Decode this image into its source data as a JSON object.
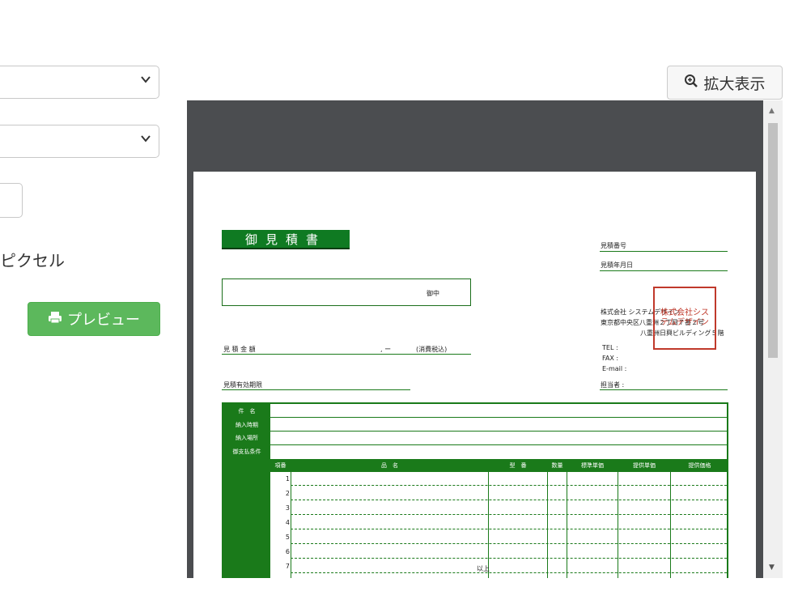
{
  "left_panel": {
    "unit_label": "ピクセル",
    "preview_button_label": "プレビュー",
    "preview_icon": "print-icon"
  },
  "toolbar": {
    "zoom_button_label": "拡大表示",
    "zoom_icon": "zoom-in-icon"
  },
  "document": {
    "title": "御見積書",
    "estimate_number_label": "見積番号",
    "estimate_date_label": "見積年月日",
    "addressee_suffix": "御中",
    "company_name": "株式会社 システムデザイン",
    "company_address_1": "東京都中央区八重洲２丁目７番２号",
    "company_address_2": "八重洲日興ビルディング５階",
    "stamp_text": "株式会社システムデザイン",
    "tel_label": "TEL  :",
    "fax_label": "FAX  :",
    "email_label": "E-mail :",
    "staff_label": "担当者 :",
    "amount_label": "見 積 金 額",
    "amount_value": ", ー",
    "tax_note": "(消費税込)",
    "validity_label": "見積有効期限",
    "form_labels": [
      "件　名",
      "納入時期",
      "納入場所",
      "御支払条件"
    ],
    "item_headers": [
      "項番",
      "品　名",
      "型　番",
      "数量",
      "標準単価",
      "提供単価",
      "提供価格"
    ],
    "row_numbers": [
      "1",
      "2",
      "3",
      "4",
      "5",
      "6",
      "7"
    ],
    "end_marker": "以上"
  },
  "colors": {
    "form_green": "#1a7a1a",
    "preview_green": "#5cb85c",
    "stamp_red": "#c0392b",
    "viewer_bg": "#4b4d50"
  }
}
